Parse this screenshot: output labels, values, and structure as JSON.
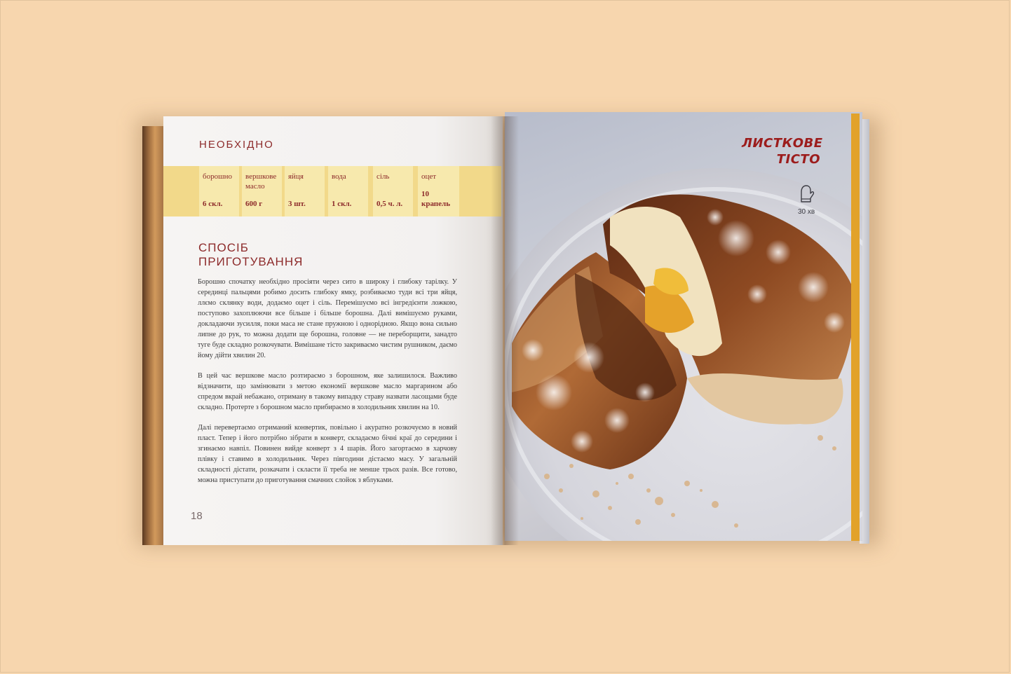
{
  "left_page": {
    "heading_needed": "НЕОБХІДНО",
    "ingredients": [
      {
        "name": "борошно",
        "qty": "6 скл."
      },
      {
        "name": "вершкове масло",
        "qty": "600 г"
      },
      {
        "name": "яйця",
        "qty": "3 шт."
      },
      {
        "name": "вода",
        "qty": "1 скл."
      },
      {
        "name": "сіль",
        "qty": "0,5 ч. л."
      },
      {
        "name": "оцет",
        "qty": "10 крапель"
      }
    ],
    "heading_method_line1": "СПОСІБ",
    "heading_method_line2": "ПРИГОТУВАННЯ",
    "paragraphs": [
      "Борошно спочатку необхідно просіяти через сито в широку і глибоку тарілку. У серединці пальцями робимо досить глибоку ямку, розбиваємо туди всі три яйця, ллємо склянку води, додаємо оцет і сіль. Перемішуємо всі інгредієнти ложкою, поступово захоплюючи все більше і більше борошна. Далі вимішуємо руками, докладаючи зусилля, поки маса не стане пружною і однорідною. Якщо вона сильно липне до рук, то можна додати ще борошна, головне — не переборщити, занадто туге буде складно розкочувати. Вимішане тісто закриваємо чистим рушником, даємо йому дійти хвилин 20.",
      "В цей час вершкове масло розтираємо з борошном, яке залишилося. Важливо відзначити, що замінювати з метою економії вершкове масло маргарином або спредом вкрай небажано, отриману в такому випадку страву назвати ласощами буде складно. Протерте з борошном масло прибираємо в холодильник хвилин на 10.",
      "Далі перевертаємо отриманий конвертик, повільно і акуратно розкочуємо в новий пласт. Тепер і його потрібно зібрати в конверт, складаємо бічні краї до середини і згинаємо навпіл. Повинен вийде конверт з 4 шарів. Його загортаємо в харчову плівку і ставимо в холодильник. Через півгодини дістаємо масу. У загальній складності дістати, розкачати і скласти її треба не менше трьох разів. Все готово, можна приступати до приготування смачних слойок з яблуками."
    ],
    "page_number": "18"
  },
  "right_page": {
    "title_line1": "ЛИСТКОВЕ",
    "title_line2": "ТІСТО",
    "time": "30 хв",
    "time_icon": "oven-mitt-icon"
  },
  "colors": {
    "accent_red": "#8d2b2b",
    "ingredient_band": "#f2d98a",
    "ingredient_cell": "#f7e9ad",
    "background": "#f7d6ae"
  }
}
